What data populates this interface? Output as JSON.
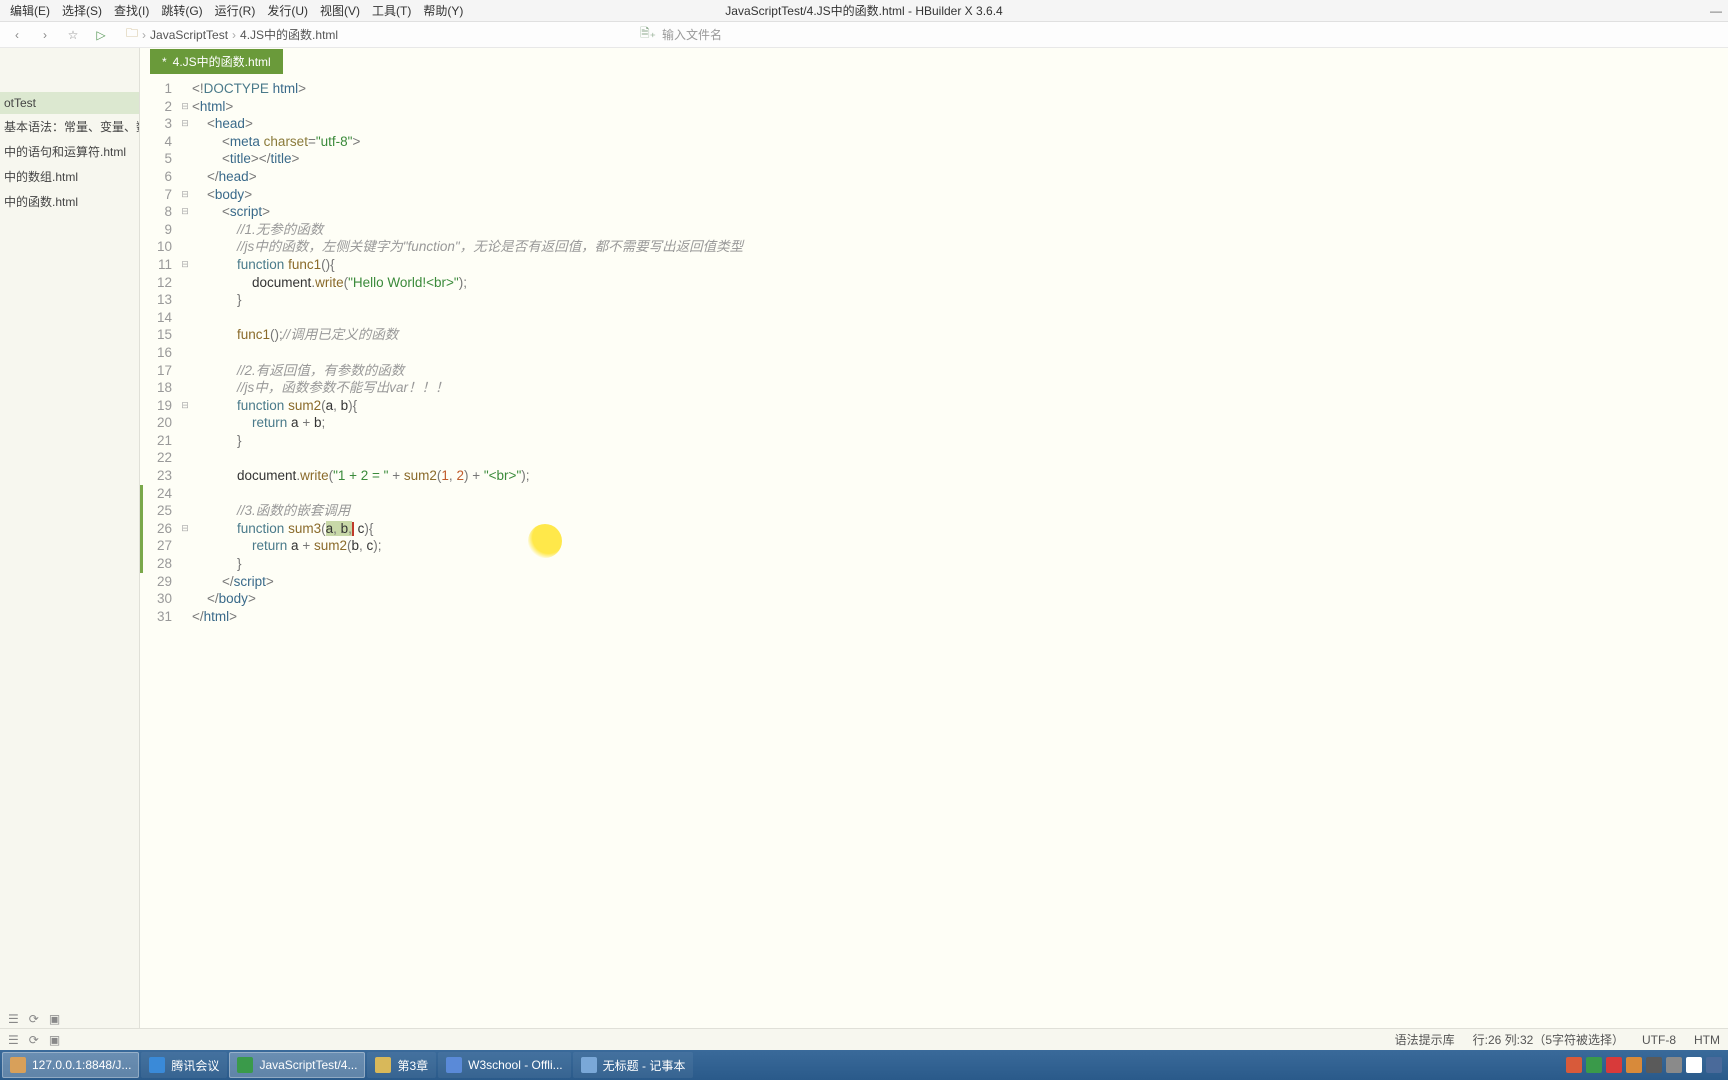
{
  "window": {
    "title": "JavaScriptTest/4.JS中的函数.html - HBuilder X 3.6.4"
  },
  "menu": {
    "items": [
      "编辑(E)",
      "选择(S)",
      "查找(I)",
      "跳转(G)",
      "运行(R)",
      "发行(U)",
      "视图(V)",
      "工具(T)",
      "帮助(Y)"
    ]
  },
  "toolbar": {
    "breadcrumb": [
      "JavaScriptTest",
      "4.JS中的函数.html"
    ],
    "newfile_placeholder": "输入文件名"
  },
  "sidebar": {
    "items": [
      {
        "label": "otTest",
        "sel": true
      },
      {
        "label": "基本语法：常量、变量、数据..."
      },
      {
        "label": "中的语句和运算符.html"
      },
      {
        "label": "中的数组.html"
      },
      {
        "label": "中的函数.html"
      }
    ]
  },
  "tab": {
    "dirty_marker": "*",
    "label": "4.JS中的函数.html"
  },
  "status": {
    "syntax_hint": "语法提示库",
    "cursor": "行:26  列:32（5字符被选择）",
    "encoding": "UTF-8",
    "lang": "HTM"
  },
  "taskbar": {
    "items": [
      {
        "label": "127.0.0.1:8848/J...",
        "color": "#d8a05a",
        "active": true
      },
      {
        "label": "腾讯会议",
        "color": "#3a8ad8"
      },
      {
        "label": "JavaScriptTest/4...",
        "color": "#3a9a4a",
        "active": true
      },
      {
        "label": "第3章",
        "color": "#d8b85a"
      },
      {
        "label": "W3school - Offli...",
        "color": "#5a8ad8"
      },
      {
        "label": "无标题 - 记事本",
        "color": "#7aa8d8"
      }
    ]
  },
  "code": {
    "lines": [
      {
        "n": 1,
        "fold": "",
        "seg": [
          [
            "punct",
            "<!"
          ],
          [
            "doctype",
            "DOCTYPE "
          ],
          [
            "tag",
            "html"
          ],
          [
            "punct",
            ">"
          ]
        ]
      },
      {
        "n": 2,
        "fold": "⊟",
        "seg": [
          [
            "punct",
            "<"
          ],
          [
            "tag",
            "html"
          ],
          [
            "punct",
            ">"
          ]
        ]
      },
      {
        "n": 3,
        "fold": "⊟",
        "indent": 1,
        "seg": [
          [
            "punct",
            "<"
          ],
          [
            "tag",
            "head"
          ],
          [
            "punct",
            ">"
          ]
        ]
      },
      {
        "n": 4,
        "fold": "",
        "indent": 2,
        "seg": [
          [
            "punct",
            "<"
          ],
          [
            "tag",
            "meta "
          ],
          [
            "attr",
            "charset"
          ],
          [
            "punct",
            "="
          ],
          [
            "str",
            "\"utf-8\""
          ],
          [
            "punct",
            ">"
          ]
        ]
      },
      {
        "n": 5,
        "fold": "",
        "indent": 2,
        "seg": [
          [
            "punct",
            "<"
          ],
          [
            "tag",
            "title"
          ],
          [
            "punct",
            "></"
          ],
          [
            "tag",
            "title"
          ],
          [
            "punct",
            ">"
          ]
        ]
      },
      {
        "n": 6,
        "fold": "",
        "indent": 1,
        "seg": [
          [
            "punct",
            "</"
          ],
          [
            "tag",
            "head"
          ],
          [
            "punct",
            ">"
          ]
        ]
      },
      {
        "n": 7,
        "fold": "⊟",
        "indent": 1,
        "seg": [
          [
            "punct",
            "<"
          ],
          [
            "tag",
            "body"
          ],
          [
            "punct",
            ">"
          ]
        ]
      },
      {
        "n": 8,
        "fold": "⊟",
        "indent": 2,
        "seg": [
          [
            "punct",
            "<"
          ],
          [
            "tag",
            "script"
          ],
          [
            "punct",
            ">"
          ]
        ]
      },
      {
        "n": 9,
        "fold": "",
        "indent": 3,
        "seg": [
          [
            "cmt",
            "//1.无参的函数"
          ]
        ]
      },
      {
        "n": 10,
        "fold": "",
        "indent": 3,
        "seg": [
          [
            "cmt",
            "//js中的函数，左侧关键字为\"function\"，无论是否有返回值，都不需要写出返回值类型"
          ]
        ]
      },
      {
        "n": 11,
        "fold": "⊟",
        "indent": 3,
        "seg": [
          [
            "kw",
            "function"
          ],
          [
            "ident",
            " "
          ],
          [
            "fn",
            "func1"
          ],
          [
            "punct",
            "(){"
          ]
        ]
      },
      {
        "n": 12,
        "fold": "",
        "indent": 4,
        "seg": [
          [
            "ident",
            "document"
          ],
          [
            "punct",
            "."
          ],
          [
            "fn",
            "write"
          ],
          [
            "punct",
            "("
          ],
          [
            "str",
            "\"Hello World!<br>\""
          ],
          [
            "punct",
            ");"
          ]
        ]
      },
      {
        "n": 13,
        "fold": "",
        "indent": 3,
        "seg": [
          [
            "punct",
            "}"
          ]
        ]
      },
      {
        "n": 14,
        "fold": "",
        "indent": 3,
        "seg": []
      },
      {
        "n": 15,
        "fold": "",
        "indent": 3,
        "seg": [
          [
            "fn",
            "func1"
          ],
          [
            "punct",
            "();"
          ],
          [
            "cmt",
            "//调用已定义的函数"
          ]
        ]
      },
      {
        "n": 16,
        "fold": "",
        "indent": 3,
        "seg": []
      },
      {
        "n": 17,
        "fold": "",
        "indent": 3,
        "seg": [
          [
            "cmt",
            "//2.有返回值，有参数的函数"
          ]
        ]
      },
      {
        "n": 18,
        "fold": "",
        "indent": 3,
        "seg": [
          [
            "cmt",
            "//js中，函数参数不能写出var！！！"
          ]
        ]
      },
      {
        "n": 19,
        "fold": "⊟",
        "indent": 3,
        "seg": [
          [
            "kw",
            "function"
          ],
          [
            "ident",
            " "
          ],
          [
            "fn",
            "sum2"
          ],
          [
            "punct",
            "("
          ],
          [
            "ident",
            "a"
          ],
          [
            "punct",
            ", "
          ],
          [
            "ident",
            "b"
          ],
          [
            "punct",
            "){"
          ]
        ]
      },
      {
        "n": 20,
        "fold": "",
        "indent": 4,
        "seg": [
          [
            "kw",
            "return"
          ],
          [
            "ident",
            " a "
          ],
          [
            "punct",
            "+"
          ],
          [
            "ident",
            " b"
          ],
          [
            "punct",
            ";"
          ]
        ]
      },
      {
        "n": 21,
        "fold": "",
        "indent": 3,
        "seg": [
          [
            "punct",
            "}"
          ]
        ]
      },
      {
        "n": 22,
        "fold": "",
        "indent": 3,
        "seg": []
      },
      {
        "n": 23,
        "fold": "",
        "indent": 3,
        "seg": [
          [
            "ident",
            "document"
          ],
          [
            "punct",
            "."
          ],
          [
            "fn",
            "write"
          ],
          [
            "punct",
            "("
          ],
          [
            "str",
            "\"1 + 2 = \""
          ],
          [
            "ident",
            " "
          ],
          [
            "punct",
            "+"
          ],
          [
            "ident",
            " "
          ],
          [
            "fn",
            "sum2"
          ],
          [
            "punct",
            "("
          ],
          [
            "num",
            "1"
          ],
          [
            "punct",
            ", "
          ],
          [
            "num",
            "2"
          ],
          [
            "punct",
            ")"
          ],
          [
            "ident",
            " "
          ],
          [
            "punct",
            "+"
          ],
          [
            "ident",
            " "
          ],
          [
            "str",
            "\"<br>\""
          ],
          [
            "punct",
            ");"
          ]
        ]
      },
      {
        "n": 24,
        "fold": "",
        "indent": 3,
        "mod": true,
        "seg": []
      },
      {
        "n": 25,
        "fold": "",
        "indent": 3,
        "mod": true,
        "seg": [
          [
            "cmt",
            "//3.函数的嵌套调用"
          ]
        ]
      },
      {
        "n": 26,
        "fold": "⊟",
        "indent": 3,
        "mod": true,
        "seg": [
          [
            "kw",
            "function"
          ],
          [
            "ident",
            " "
          ],
          [
            "fn",
            "sum3"
          ],
          [
            "punct",
            "("
          ],
          [
            "selstart",
            ""
          ],
          [
            "ident",
            "a"
          ],
          [
            "punct",
            ", "
          ],
          [
            "ident",
            "b"
          ],
          [
            "punct",
            ","
          ],
          [
            "selend",
            ""
          ],
          [
            "cursor",
            ""
          ],
          [
            "ident",
            " c"
          ],
          [
            "punct",
            "){"
          ]
        ]
      },
      {
        "n": 27,
        "fold": "",
        "indent": 4,
        "mod": true,
        "seg": [
          [
            "kw",
            "return"
          ],
          [
            "ident",
            " a "
          ],
          [
            "punct",
            "+"
          ],
          [
            "ident",
            " "
          ],
          [
            "fn",
            "sum2"
          ],
          [
            "punct",
            "("
          ],
          [
            "ident",
            "b"
          ],
          [
            "punct",
            ", "
          ],
          [
            "ident",
            "c"
          ],
          [
            "punct",
            ");"
          ]
        ]
      },
      {
        "n": 28,
        "fold": "",
        "indent": 3,
        "mod": true,
        "seg": [
          [
            "punct",
            "}"
          ]
        ]
      },
      {
        "n": 29,
        "fold": "",
        "indent": 2,
        "seg": [
          [
            "punct",
            "</"
          ],
          [
            "tag",
            "script"
          ],
          [
            "punct",
            ">"
          ]
        ]
      },
      {
        "n": 30,
        "fold": "",
        "indent": 1,
        "seg": [
          [
            "punct",
            "</"
          ],
          [
            "tag",
            "body"
          ],
          [
            "punct",
            ">"
          ]
        ]
      },
      {
        "n": 31,
        "fold": "",
        "seg": [
          [
            "punct",
            "</"
          ],
          [
            "tag",
            "html"
          ],
          [
            "punct",
            ">"
          ]
        ]
      }
    ]
  }
}
